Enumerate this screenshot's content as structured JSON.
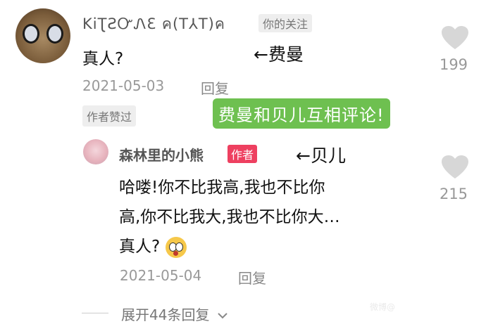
{
  "comment": {
    "username": "KiƮƧᏅᏁƐ ค(T⅄T)ค",
    "follow_badge": "你的关注",
    "text": "真人?",
    "date": "2021-05-03",
    "reply_label": "回复",
    "likes": "199",
    "author_liked": "作者赞过"
  },
  "annotations": {
    "arrow_fei_man": "←费曼",
    "arrow_bei_er": "←贝儿",
    "green_note": "费曼和贝儿互相评论!"
  },
  "reply": {
    "username": "森林里的小熊",
    "author_tag": "作者",
    "lines": [
      "哈喽!你不比我高,我也不比你",
      "高,你不比我大,我也不比你大…",
      "真人?"
    ],
    "date": "2021-05-04",
    "reply_label": "回复",
    "likes": "215"
  },
  "expand_label": "展开44条回复",
  "watermark": "微博@",
  "icons": {
    "heart": "heart-icon",
    "chevron": "chevron-down-icon",
    "emoji": "shocked-face-emoji"
  },
  "colors": {
    "accent_green": "#6ec050",
    "author_red": "#ee4060",
    "muted_text": "#999999"
  }
}
